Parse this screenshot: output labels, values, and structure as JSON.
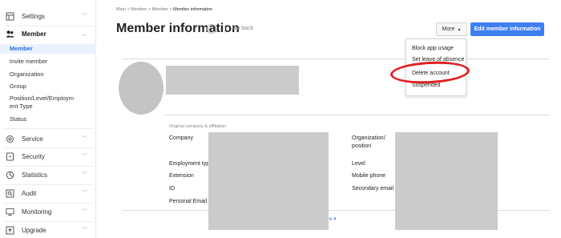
{
  "sidebar": {
    "groups": [
      {
        "label": "Settings",
        "icon": "settings-icon"
      },
      {
        "label": "Member",
        "icon": "member-icon",
        "expanded": true
      },
      {
        "label": "Service",
        "icon": "service-icon"
      },
      {
        "label": "Security",
        "icon": "security-icon"
      },
      {
        "label": "Statistics",
        "icon": "statistics-icon"
      },
      {
        "label": "Audit",
        "icon": "audit-icon"
      },
      {
        "label": "Monitoring",
        "icon": "monitoring-icon"
      },
      {
        "label": "Upgrade",
        "icon": "upgrade-icon"
      }
    ],
    "member_items": [
      "Member",
      "Invite member",
      "Organization",
      "Group",
      "Position/Level/Employm",
      "ent Type",
      "Status"
    ],
    "active_item": "Member"
  },
  "breadcrumb": {
    "items": [
      "Main",
      "Member",
      "Member",
      "Member information"
    ],
    "separator": ">"
  },
  "header": {
    "title": "Member information",
    "help_glyph": "?",
    "go_back": "Go back",
    "more_label": "More",
    "edit_label": "Edit member information"
  },
  "dropdown": {
    "items": [
      "Block app usage",
      "Set leave of absence",
      "Delete account",
      "Suspended"
    ],
    "highlighted": "Delete account"
  },
  "details": {
    "section_caption": "Original company & affiliation",
    "left_fields": [
      "Company",
      "Employment typ",
      "Extension",
      "ID",
      "Personal Email"
    ],
    "right_fields": [
      "Organization/",
      "position",
      "Level",
      "Mobile phone",
      "Secondary email"
    ],
    "more_link": "ore"
  },
  "colors": {
    "accent": "#3d7ff0",
    "active_bg": "#eaf2fe",
    "annotation": "#e02020",
    "redaction": "#cbcbcb"
  }
}
